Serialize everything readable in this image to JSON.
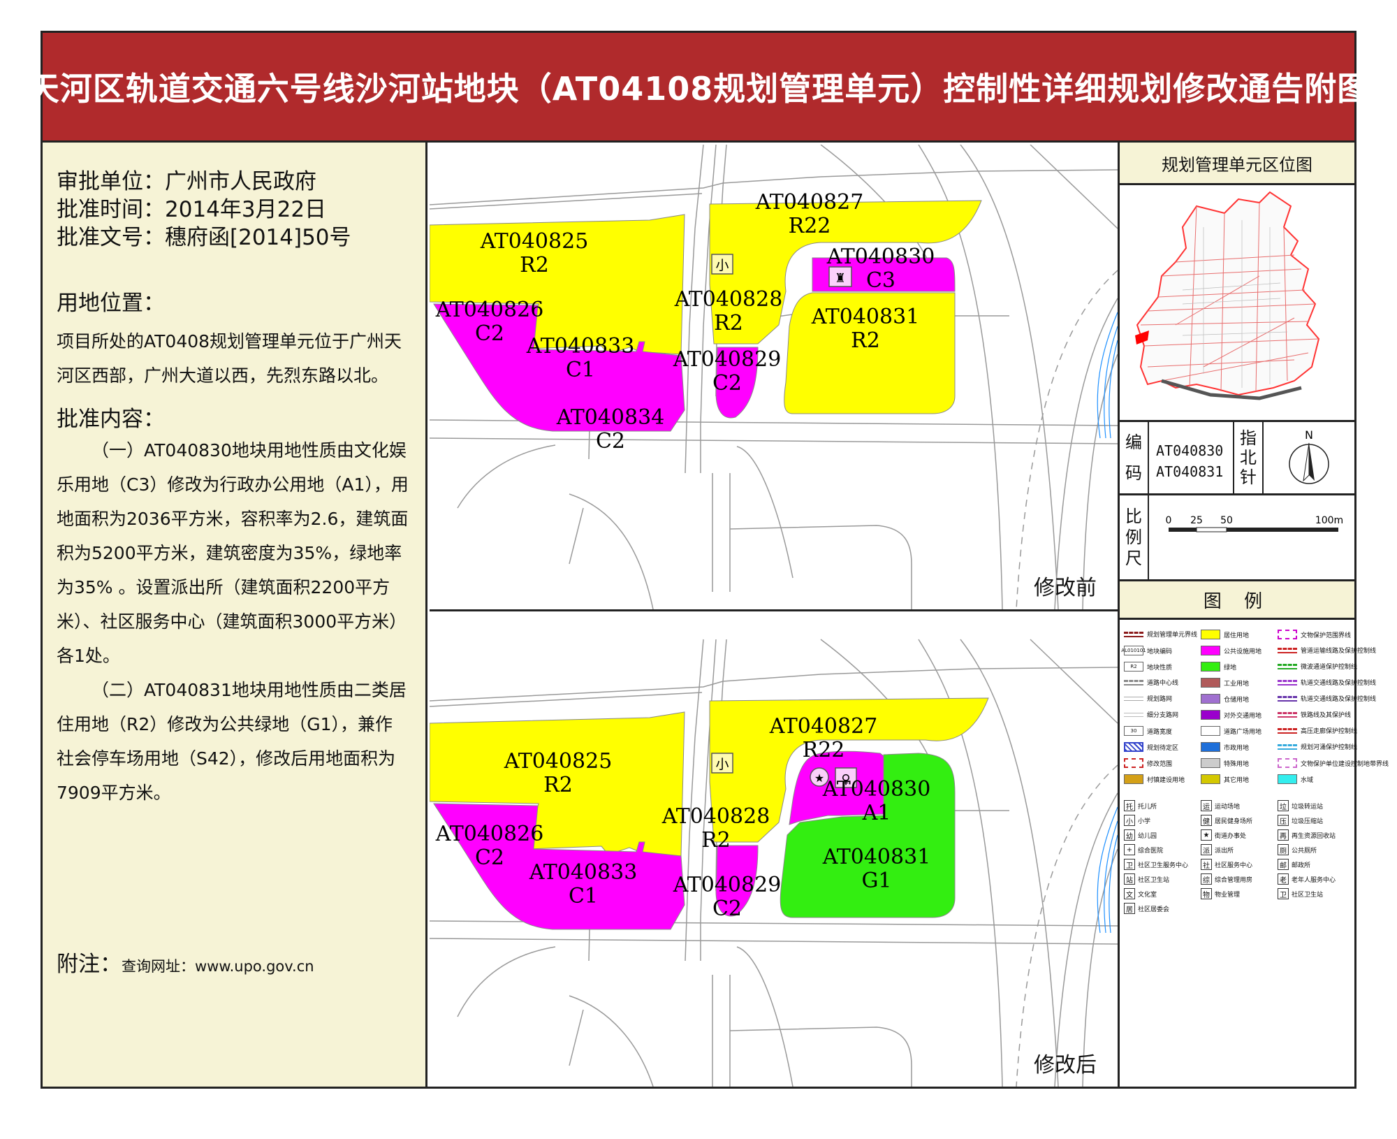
{
  "title": "天河区轨道交通六号线沙河站地块（AT04108规划管理单元）控制性详细规划修改通告附图",
  "info": {
    "approver": "审批单位：广州市人民政府",
    "date": "批准时间：2014年3月22日",
    "doc_no": "批准文号：穗府函[2014]50号"
  },
  "location": {
    "heading": "用地位置：",
    "text": "项目所处的AT0408规划管理单元位于广州天河区西部，广州大道以西，先烈东路以北。"
  },
  "content": {
    "heading": "批准内容：",
    "item1": "（一）AT040830地块用地性质由文化娱乐用地（C3）修改为行政办公用地（A1），用地面积为2036平方米，容积率为2.6，建筑面积为5200平方米，建筑密度为35%，绿地率为35% 。设置派出所（建筑面积2200平方米）、社区服务中心（建筑面积3000平方米）各1处。",
    "item2": "（二）AT040831地块用地性质由二类居住用地（R2）修改为公共绿地（G1），兼作社会停车场用地（S42），修改后用地面积为7909平方米。"
  },
  "note": {
    "label": "附注：",
    "text": "查询网址：www.upo.gov.cn"
  },
  "colors": {
    "residential": "#ffff00",
    "public": "#ff00ff",
    "green": "#33ee11",
    "title_bg": "#b02a2c",
    "panel_bg": "#f6f3d6"
  },
  "map_before": {
    "caption": "修改前",
    "icon_school": "小",
    "parcels": [
      {
        "id": "AT040825",
        "type": "R2"
      },
      {
        "id": "AT040826",
        "type": "C2"
      },
      {
        "id": "AT040827",
        "type": "R22"
      },
      {
        "id": "AT040828",
        "type": "R2"
      },
      {
        "id": "AT040829",
        "type": "C2"
      },
      {
        "id": "AT040830",
        "type": "C3"
      },
      {
        "id": "AT040831",
        "type": "R2"
      },
      {
        "id": "AT040833",
        "type": "C1"
      },
      {
        "id": "AT040834",
        "type": "C2"
      }
    ]
  },
  "map_after": {
    "caption": "修改后",
    "icon_school": "小",
    "parcels": [
      {
        "id": "AT040825",
        "type": "R2"
      },
      {
        "id": "AT040826",
        "type": "C2"
      },
      {
        "id": "AT040827",
        "type": "R22"
      },
      {
        "id": "AT040828",
        "type": "R2"
      },
      {
        "id": "AT040829",
        "type": "C2"
      },
      {
        "id": "AT040830",
        "type": "A1"
      },
      {
        "id": "AT040831",
        "type": "G1"
      },
      {
        "id": "AT040833",
        "type": "C1"
      }
    ]
  },
  "right": {
    "location_map_title": "规划管理单元区位图",
    "code_label": [
      "编",
      "码"
    ],
    "codes": [
      "AT040830",
      "AT040831"
    ],
    "north_label": [
      "指",
      "北",
      "针"
    ],
    "north_letter": "N",
    "scale_label": [
      "比",
      "例",
      "尺"
    ],
    "scale_ticks": [
      "0",
      "25",
      "50",
      "100m"
    ],
    "legend_title": "图  例"
  },
  "legend_items": [
    {
      "label": "规划管理单元界线",
      "color": "#8b1a1a",
      "style": "dash"
    },
    {
      "label": "居住用地",
      "color": "#ffff00",
      "style": "fill"
    },
    {
      "label": "文物保护范围界线",
      "color": "#cc00cc",
      "style": "dashbox"
    },
    {
      "label": "地块编码",
      "color": "#333333",
      "style": "text",
      "text": "AL010101"
    },
    {
      "label": "公共设施用地",
      "color": "#ff00ff",
      "style": "fill"
    },
    {
      "label": "管道运输线路及保护控制线",
      "color": "#cc2222",
      "style": "dash"
    },
    {
      "label": "地块性质",
      "color": "#333333",
      "style": "box",
      "text": "R2"
    },
    {
      "label": "绿地",
      "color": "#33ee11",
      "style": "fill"
    },
    {
      "label": "微波通道保护控制线",
      "color": "#22aa22",
      "style": "dash"
    },
    {
      "label": "道路中心线",
      "color": "#888888",
      "style": "dash"
    },
    {
      "label": "工业用地",
      "color": "#b05a5a",
      "style": "fill"
    },
    {
      "label": "轨道交通线路及保护控制线",
      "color": "#9933cc",
      "style": "dash"
    },
    {
      "label": "规划路网",
      "color": "#aaaaaa",
      "style": "line"
    },
    {
      "label": "仓储用地",
      "color": "#a070d0",
      "style": "fill"
    },
    {
      "label": "轨道交通线路及保护控制线",
      "color": "#6633aa",
      "style": "dash"
    },
    {
      "label": "细分支路网",
      "color": "#bbbbbb",
      "style": "line"
    },
    {
      "label": "对外交通用地",
      "color": "#9a00cc",
      "style": "fill"
    },
    {
      "label": "铁路线及其保护线",
      "color": "#cc3366",
      "style": "dash"
    },
    {
      "label": "道路宽度",
      "color": "#333333",
      "style": "text",
      "text": "30"
    },
    {
      "label": "道路广场用地",
      "color": "#ffffff",
      "style": "fill"
    },
    {
      "label": "高压走廊保护控制线",
      "color": "#cc2222",
      "style": "dash"
    },
    {
      "label": "规划待定区",
      "color": "#3344cc",
      "style": "hatch"
    },
    {
      "label": "市政用地",
      "color": "#1e6fd9",
      "style": "fill"
    },
    {
      "label": "规划河涌保护控制线",
      "color": "#33aadd",
      "style": "dash"
    },
    {
      "label": "修改范围",
      "color": "#cc2222",
      "style": "dashbox"
    },
    {
      "label": "特殊用地",
      "color": "#cccccc",
      "style": "fill"
    },
    {
      "label": "文物保护单位建设控制地带界线",
      "color": "#cc66cc",
      "style": "dashbox"
    },
    {
      "label": "村镇建设用地",
      "color": "#d4a017",
      "style": "fill"
    },
    {
      "label": "其它用地",
      "color": "#d4c800",
      "style": "fill"
    },
    {
      "label": "水域",
      "color": "#33eeee",
      "style": "fill"
    }
  ],
  "legend_icons": [
    {
      "glyph": "托",
      "label": "托儿所"
    },
    {
      "glyph": "运",
      "label": "运动场地"
    },
    {
      "glyph": "垃",
      "label": "垃圾转运站"
    },
    {
      "glyph": "小",
      "label": "小学"
    },
    {
      "glyph": "健",
      "label": "居民健身场所"
    },
    {
      "glyph": "压",
      "label": "垃圾压缩站"
    },
    {
      "glyph": "幼",
      "label": "幼儿园"
    },
    {
      "glyph": "★",
      "label": "街道办事处"
    },
    {
      "glyph": "再",
      "label": "再生资源回收站"
    },
    {
      "glyph": "+",
      "label": "综合医院"
    },
    {
      "glyph": "派",
      "label": "派出所"
    },
    {
      "glyph": "厕",
      "label": "公共厕所"
    },
    {
      "glyph": "卫",
      "label": "社区卫生服务中心"
    },
    {
      "glyph": "社",
      "label": "社区服务中心"
    },
    {
      "glyph": "邮",
      "label": "邮政所"
    },
    {
      "glyph": "站",
      "label": "社区卫生站"
    },
    {
      "glyph": "综",
      "label": "综合管理用房"
    },
    {
      "glyph": "老",
      "label": "老年人服务中心"
    },
    {
      "glyph": "文",
      "label": "文化室"
    },
    {
      "glyph": "物",
      "label": "物业管理"
    },
    {
      "glyph": "卫",
      "label": "社区卫生站"
    },
    {
      "glyph": "居",
      "label": "社区居委会"
    }
  ]
}
